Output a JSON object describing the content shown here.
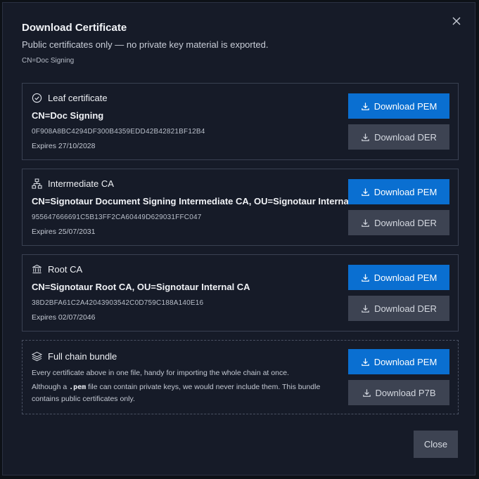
{
  "dialog": {
    "title": "Download Certificate",
    "subtitle": "Public certificates only — no private key material is exported.",
    "subject": "CN=Doc Signing",
    "close_label": "Close"
  },
  "certificates": [
    {
      "icon": "check-circle-icon",
      "heading": "Leaf certificate",
      "cn": "CN=Doc Signing",
      "fingerprint": "0F908A8BC4294DF300B4359EDD42B42821BF12B4",
      "expires": "Expires 27/10/2028",
      "primary_label": "Download PEM",
      "secondary_label": "Download DER"
    },
    {
      "icon": "hierarchy-icon",
      "heading": "Intermediate CA",
      "cn": "CN=Signotaur Document Signing Intermediate CA, OU=Signotaur Internal CA",
      "fingerprint": "955647666691C5B13FF2CA60449D629031FFC047",
      "expires": "Expires 25/07/2031",
      "primary_label": "Download PEM",
      "secondary_label": "Download DER"
    },
    {
      "icon": "bank-icon",
      "heading": "Root CA",
      "cn": "CN=Signotaur Root CA, OU=Signotaur Internal CA",
      "fingerprint": "38D2BFA61C2A42043903542C0D759C188A140E16",
      "expires": "Expires 02/07/2046",
      "primary_label": "Download PEM",
      "secondary_label": "Download DER"
    }
  ],
  "bundle": {
    "icon": "layers-icon",
    "heading": "Full chain bundle",
    "description": "Every certificate above in one file, handy for importing the whole chain at once.",
    "note_prefix": "Although a ",
    "note_code": ".pem",
    "note_suffix_line1": " file can contain private keys, we would never include them. This bundle",
    "note_line2": "contains public certificates only.",
    "primary_label": "Download PEM",
    "secondary_label": "Download P7B"
  },
  "colors": {
    "accent": "#0a6fd1",
    "background": "#161b28",
    "secondary_button": "#3d4352"
  }
}
